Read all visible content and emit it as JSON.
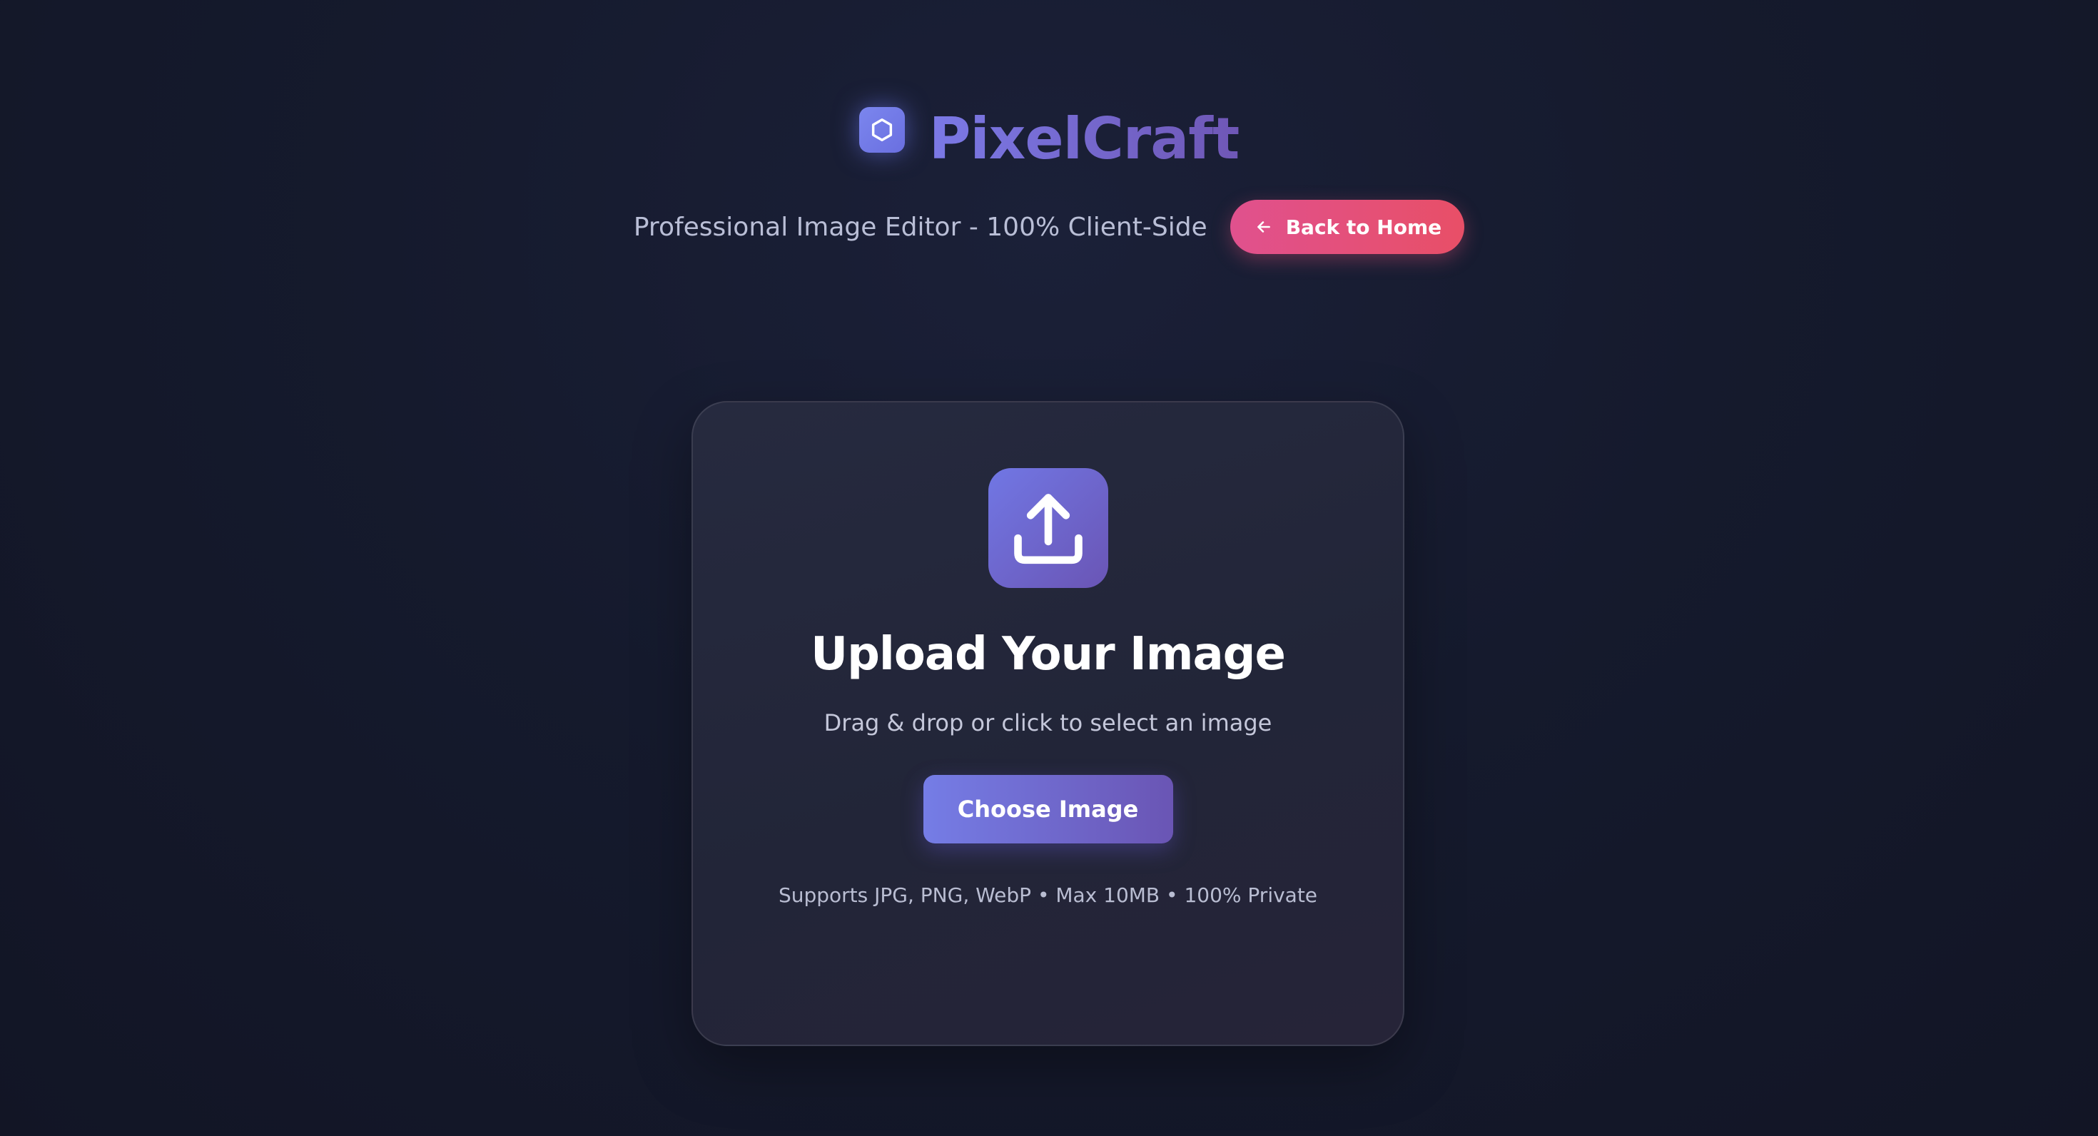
{
  "brand": {
    "name": "PixelCraft",
    "logo_icon": "hexagon-icon"
  },
  "header": {
    "tagline": "Professional Image Editor - 100% Client-Side",
    "back_button": {
      "label": "Back to Home",
      "icon": "arrow-left-icon"
    }
  },
  "upload": {
    "icon": "upload-icon",
    "title": "Upload Your Image",
    "subtitle": "Drag & drop or click to select an image",
    "choose_button": "Choose Image",
    "supports": "Supports JPG, PNG, WebP • Max 10MB • 100% Private"
  },
  "colors": {
    "accent": "#6f74e0",
    "accent_secondary": "#6a55b5",
    "back_button": "#e4507c",
    "background": "#151a2d"
  }
}
